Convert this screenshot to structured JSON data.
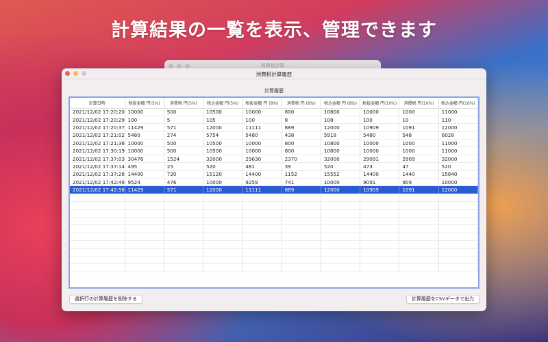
{
  "headline": "計算結果の一覧を表示、管理できます",
  "back_window": {
    "title": "消費税計算"
  },
  "window": {
    "title": "消費税計算履歴",
    "section_label": "計算履歴"
  },
  "table": {
    "columns": [
      "計算日時",
      "税抜金額 円(5%)",
      "消費税 円(5%)",
      "税込金額 円(5%)",
      "税抜金額 円 (8%)",
      "消費税 円 (8%)",
      "税込金額 円 (8%)",
      "税抜金額 円(10%)",
      "消費税 円(10%)",
      "税込金額 円(10%)"
    ],
    "rows": [
      [
        "2021/12/02 17:20:20",
        "10000",
        "500",
        "10500",
        "10000",
        "800",
        "10800",
        "10000",
        "1000",
        "11000"
      ],
      [
        "2021/12/02 17:20:29",
        "100",
        "5",
        "105",
        "100",
        "8",
        "108",
        "100",
        "10",
        "110"
      ],
      [
        "2021/12/02 17:20:37",
        "11429",
        "571",
        "12000",
        "11111",
        "889",
        "12000",
        "10909",
        "1091",
        "12000"
      ],
      [
        "2021/12/02 17:21:02",
        "5480",
        "274",
        "5754",
        "5480",
        "438",
        "5918",
        "5480",
        "548",
        "6028"
      ],
      [
        "2021/12/02 17:21:36",
        "10000",
        "500",
        "10500",
        "10000",
        "800",
        "10800",
        "10000",
        "1000",
        "11000"
      ],
      [
        "2021/12/02 17:30:19",
        "10000",
        "500",
        "10500",
        "10000",
        "800",
        "10800",
        "10000",
        "1000",
        "11000"
      ],
      [
        "2021/12/02 17:37:03",
        "30476",
        "1524",
        "32000",
        "29630",
        "2370",
        "32000",
        "29091",
        "2909",
        "32000"
      ],
      [
        "2021/12/02 17:37:14",
        "495",
        "25",
        "520",
        "481",
        "39",
        "520",
        "473",
        "47",
        "520"
      ],
      [
        "2021/12/02 17:37:26",
        "14400",
        "720",
        "15120",
        "14400",
        "1152",
        "15552",
        "14400",
        "1440",
        "15840"
      ],
      [
        "2021/12/02 17:42:49",
        "9524",
        "476",
        "10000",
        "9259",
        "741",
        "10000",
        "9091",
        "909",
        "10000"
      ],
      [
        "2021/12/02 17:42:58",
        "11429",
        "571",
        "12000",
        "11111",
        "889",
        "12000",
        "10909",
        "1091",
        "12000"
      ]
    ],
    "selected_row": 10,
    "empty_rows": 10
  },
  "buttons": {
    "delete": "選択行の計算履歴を削除する",
    "export": "計算履歴をCSVデータで出力"
  }
}
